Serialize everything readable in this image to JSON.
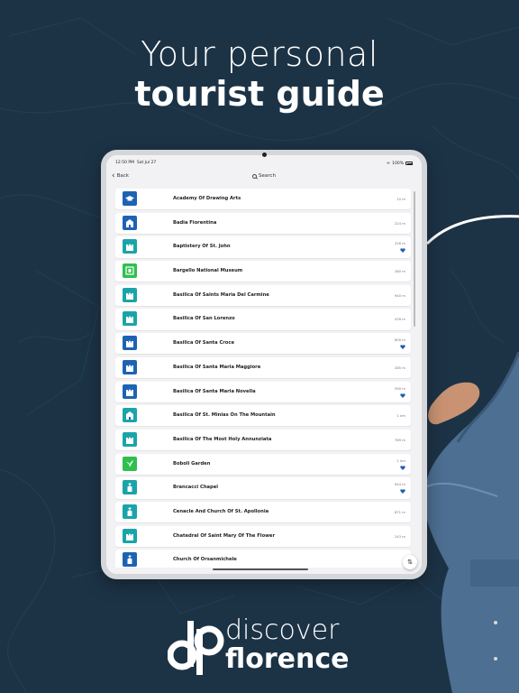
{
  "marketing": {
    "headline_light": "Your personal",
    "headline_bold": "tourist guide"
  },
  "brand": {
    "word1": "discover",
    "word2": "florence",
    "monogram": "dp"
  },
  "status_bar": {
    "time": "12:50 PM",
    "date": "Sat Jul 27",
    "battery": "100%"
  },
  "nav": {
    "back_label": "Back",
    "search_label": "Search"
  },
  "colors": {
    "background": "#1c3346",
    "blue": "#1d63b3",
    "teal": "#1aa4a9",
    "green": "#2fbf4f",
    "heart": "#1d5fb0"
  },
  "places": [
    {
      "name": "Academy Of Drawing Arts",
      "distance": "10 m",
      "icon": "graduation-cap-icon",
      "color": "blue",
      "favorite": false
    },
    {
      "name": "Badia Fiorentina",
      "distance": "224 m",
      "icon": "church-icon",
      "color": "blue",
      "favorite": false
    },
    {
      "name": "Baptistery Of St. John",
      "distance": "226 m",
      "icon": "cathedral-icon",
      "color": "teal",
      "favorite": true
    },
    {
      "name": "Bargello National Museum",
      "distance": "280 m",
      "icon": "museum-icon",
      "color": "green",
      "favorite": false
    },
    {
      "name": "Basilica Of Saints Maria Del Carmine",
      "distance": "940 m",
      "icon": "cathedral-icon",
      "color": "teal",
      "favorite": false
    },
    {
      "name": "Basilica Of San Lorenzo",
      "distance": "439 m",
      "icon": "cathedral-icon",
      "color": "teal",
      "favorite": false
    },
    {
      "name": "Basilica Of Santa Croce",
      "distance": "600 m",
      "icon": "cathedral-icon",
      "color": "blue",
      "favorite": true
    },
    {
      "name": "Basilica Of Santa Maria Maggiore",
      "distance": "285 m",
      "icon": "cathedral-icon",
      "color": "blue",
      "favorite": false
    },
    {
      "name": "Basilica Of Santa Maria Novella",
      "distance": "590 m",
      "icon": "cathedral-icon",
      "color": "blue",
      "favorite": true
    },
    {
      "name": "Basilica Of St. Minias On The Mountain",
      "distance": "1 km",
      "icon": "church-icon",
      "color": "teal",
      "favorite": false
    },
    {
      "name": "Basilica Of The Most Holy Annunziata",
      "distance": "789 m",
      "icon": "cathedral-icon",
      "color": "teal",
      "favorite": false
    },
    {
      "name": "Boboli Garden",
      "distance": "1 km",
      "icon": "garden-icon",
      "color": "green",
      "favorite": true
    },
    {
      "name": "Brancacci Chapel",
      "distance": "944 m",
      "icon": "chapel-icon",
      "color": "teal",
      "favorite": true
    },
    {
      "name": "Cenacle And Church Of St. Apollonia",
      "distance": "871 m",
      "icon": "chapel-icon",
      "color": "teal",
      "favorite": false
    },
    {
      "name": "Chatedral Of Saint Mary Of The Flower",
      "distance": "243 m",
      "icon": "cathedral-icon",
      "color": "teal",
      "favorite": false
    },
    {
      "name": "Church Of Orsanmichele",
      "distance": "",
      "icon": "chapel-icon",
      "color": "blue",
      "favorite": false
    }
  ]
}
